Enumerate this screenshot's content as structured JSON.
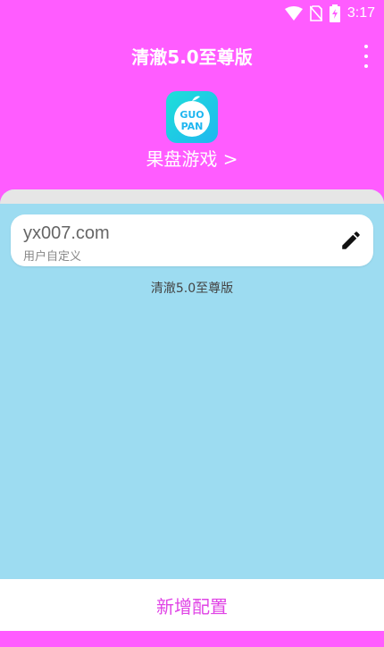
{
  "status_bar": {
    "time": "3:17",
    "icons": [
      "wifi-icon",
      "no-sim-icon",
      "battery-charging-icon"
    ]
  },
  "app_bar": {
    "title": "清澈5.0至尊版",
    "menu_icon": "more-vert-icon"
  },
  "header": {
    "logo_icon": "guo-pan-logo",
    "logo_text": [
      "GUO",
      "PAN"
    ],
    "game_link": "果盘游戏 >"
  },
  "config_card": {
    "title": "yx007.com",
    "subtitle": "用户自定义",
    "edit_icon": "pencil-icon"
  },
  "config_name": "清澈5.0至尊版",
  "footer": {
    "add_button": "新增配置"
  },
  "colors": {
    "background": "#ff5cff",
    "sheet": "#9ddcf1",
    "accent": "#e045e6",
    "logo": "#1fb6f0"
  }
}
